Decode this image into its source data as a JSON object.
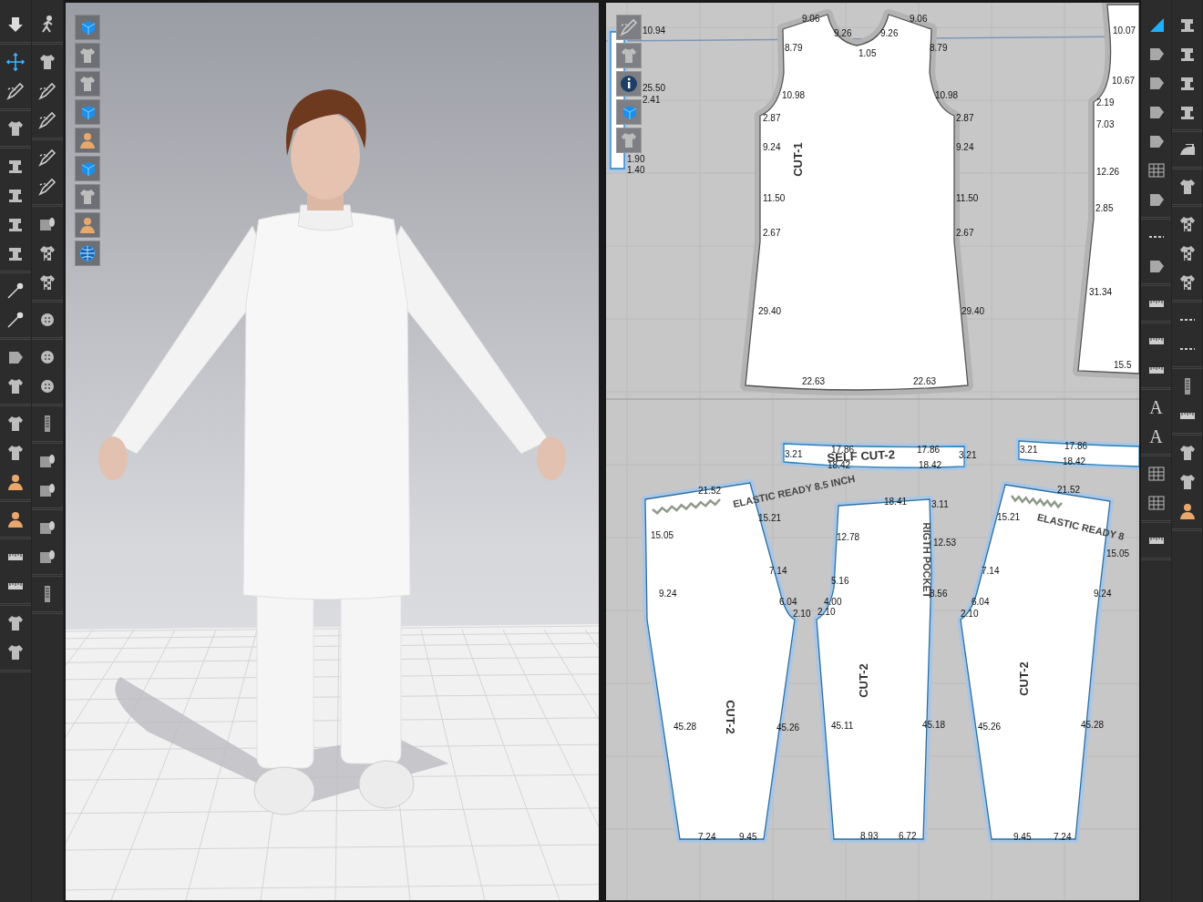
{
  "pattern_window": {
    "pieces": [
      {
        "kind": "band",
        "measurements": [
          "10.94",
          "25.50",
          "2.41",
          "1.90",
          "1.40"
        ]
      },
      {
        "kind": "bodice",
        "label": "CUT-1",
        "measurements": [
          "9.06",
          "9.26",
          "1.05",
          "9.26",
          "9.06",
          "8.79",
          "8.79",
          "10.98",
          "10.98",
          "2.87",
          "2.87",
          "9.24",
          "9.24",
          "11.50",
          "11.50",
          "2.67",
          "2.67",
          "29.40",
          "29.40",
          "22.63",
          "22.63"
        ]
      },
      {
        "kind": "bodice",
        "measurements": [
          "10.07",
          "10.67",
          "2.19",
          "7.03",
          "12.26",
          "2.85",
          "31.34",
          "15.5"
        ]
      },
      {
        "kind": "band",
        "label": "SELF CUT-2",
        "measurements": [
          "3.21",
          "17.86",
          "18.42",
          "17.86",
          "18.42",
          "3.21"
        ]
      },
      {
        "kind": "band",
        "measurements": [
          "3.21",
          "17.86",
          "18.42"
        ]
      },
      {
        "kind": "trouser",
        "label": "CUT-2",
        "note": "ELASTIC READY 8.5 INCH",
        "measurements": [
          "21.52",
          "15.21",
          "15.05",
          "7.14",
          "9.24",
          "6.04",
          "2.10",
          "45.28",
          "45.26",
          "7.24",
          "9.45"
        ]
      },
      {
        "kind": "trouser",
        "label": "CUT-2",
        "note": "RIGTH POCKET",
        "measurements": [
          "18.41",
          "3.11",
          "12.78",
          "12.53",
          "5.16",
          "4.00",
          "8.56",
          "2.10",
          "45.11",
          "45.18",
          "8.93",
          "6.72"
        ]
      },
      {
        "kind": "trouser",
        "label": "CUT-2",
        "note": "ELASTIC READY 8",
        "measurements": [
          "21.52",
          "15.21",
          "15.05",
          "7.14",
          "9.24",
          "6.04",
          "2.10",
          "45.26",
          "45.28",
          "9.45",
          "7.24"
        ]
      }
    ]
  },
  "right_toolbar": {
    "glyphs": [
      "A",
      "A"
    ]
  }
}
